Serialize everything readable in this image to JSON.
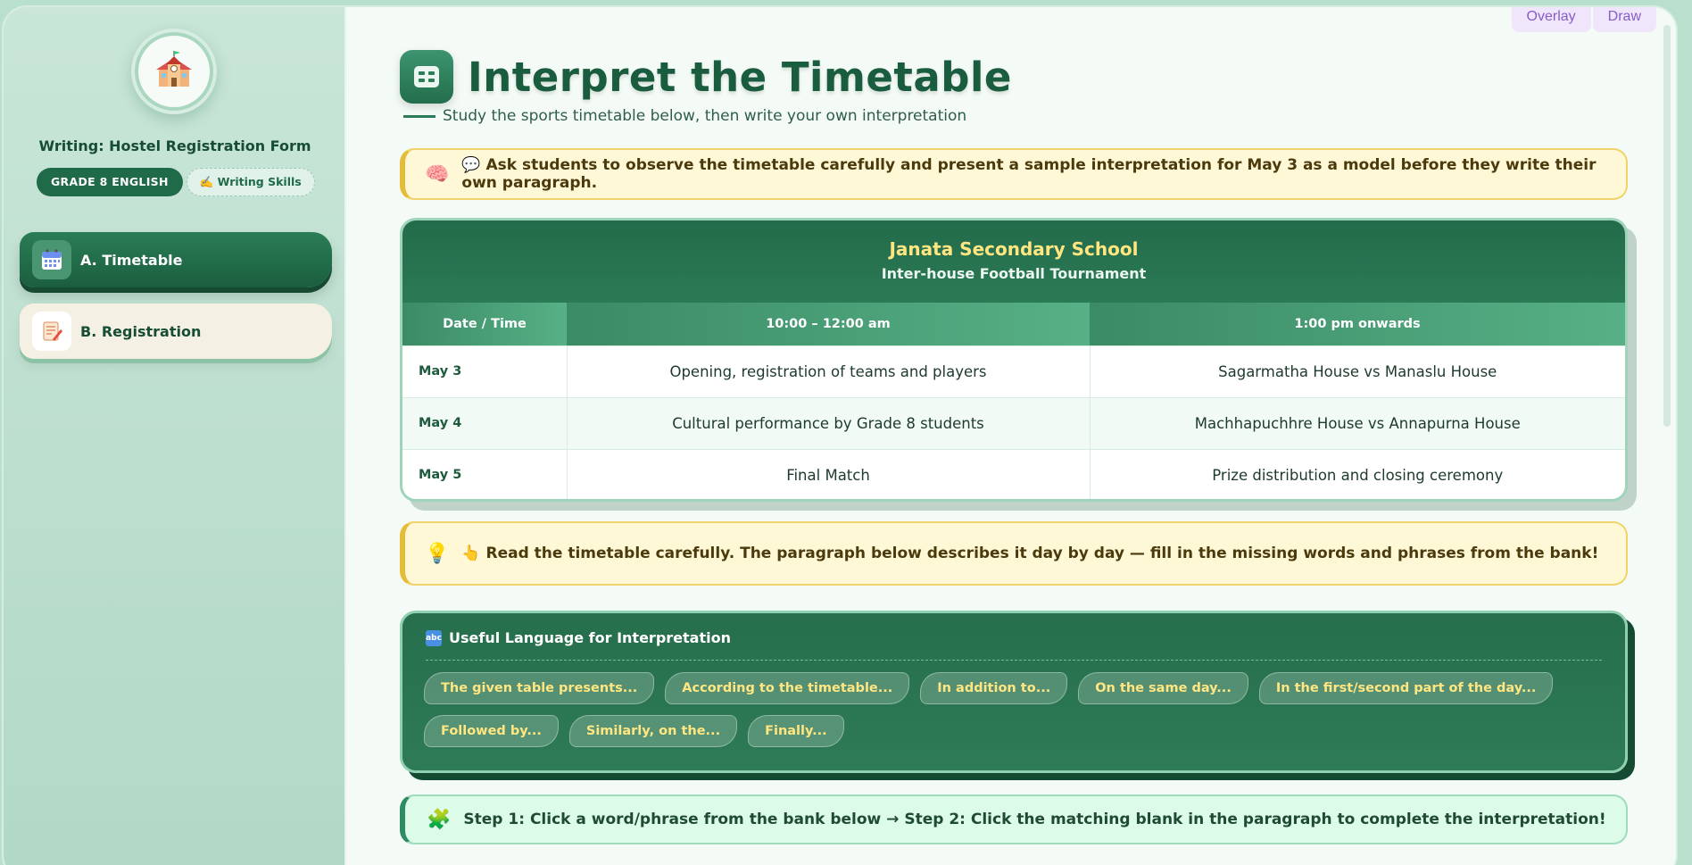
{
  "tools": [
    "Overlay",
    "Draw"
  ],
  "sidebar": {
    "course_title": "Writing: Hostel Registration Form",
    "badge_grade": "GRADE 8 ENGLISH",
    "badge_skill": "✍️ Writing Skills",
    "items": [
      {
        "label": "A. Timetable",
        "icon": "calendar-icon",
        "active": true
      },
      {
        "label": "B. Registration",
        "icon": "memo-icon",
        "active": false
      }
    ]
  },
  "main": {
    "title": "Interpret the Timetable",
    "subtitle": "Study the sports timetable below, then write your own interpretation",
    "teacher_hint": "💬 Ask students to observe the timetable carefully and present a sample interpretation for May 3 as a model before they write their own paragraph.",
    "timetable": {
      "school": "Janata Secondary School",
      "event": "Inter-house Football Tournament",
      "headers": [
        "Date / Time",
        "10:00 – 12:00 am",
        "1:00 pm onwards"
      ],
      "rows": [
        [
          "May 3",
          "Opening, registration of teams and players",
          "Sagarmatha House vs Manaslu House"
        ],
        [
          "May 4",
          "Cultural performance by Grade 8 students",
          "Machhapuchhre House vs Annapurna House"
        ],
        [
          "May 5",
          "Final Match",
          "Prize distribution and closing ceremony"
        ]
      ]
    },
    "read_hint": "👆 Read the timetable carefully. The paragraph below describes it day by day — fill in the missing words and phrases from the bank!",
    "language": {
      "title": "Useful Language for Interpretation",
      "chips": [
        "The given table presents...",
        "According to the timetable...",
        "In addition to...",
        "On the same day...",
        "In the first/second part of the day...",
        "Followed by...",
        "Similarly, on the...",
        "Finally..."
      ]
    },
    "steps": "Step 1: Click a word/phrase from the bank below → Step 2: Click the matching blank in the paragraph to complete the interpretation!"
  },
  "colors": {
    "accent": "#1f6a48",
    "hint_bg": "#fff8d6",
    "chip_text": "#ffe680"
  }
}
